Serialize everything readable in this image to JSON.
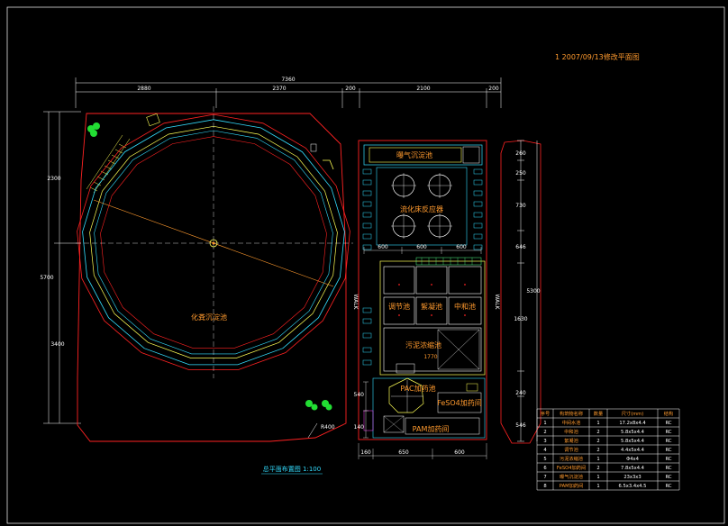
{
  "drawing": {
    "header_note": "1    2007/09/13修改平面图",
    "caption": "总平面布置图 1:100",
    "overall_dim": "7360",
    "top_dims": [
      "2880",
      "2370",
      "200",
      "2100",
      "200"
    ],
    "left_dims": [
      "2300",
      "5700",
      "3400"
    ],
    "right_total": "5300",
    "right_dims": [
      "260",
      "250",
      "730",
      "646",
      "1630",
      "240",
      "546"
    ],
    "mid_dims": [
      "600",
      "600",
      "600"
    ],
    "bottom_dims": [
      "160",
      "650",
      "600"
    ],
    "side_small_dims": [
      "540",
      "140"
    ],
    "walk_labels": [
      "WALK",
      "WALK"
    ],
    "r_label": "R400",
    "labels": {
      "big_tank": "化粪沉淀池",
      "top_room": "曝气沉淀池",
      "reactor_group": "流化床反应器",
      "tank1": "调节池",
      "tank2": "絮凝池",
      "tank3": "中和池",
      "sludge": "污泥浓缩池",
      "sludge_dim": "1770",
      "pac_tank": "PAC加药池",
      "feso4_room": "FeSO4加药间",
      "pam_room": "PAM加药间"
    }
  },
  "legend": {
    "headers": [
      "序号",
      "构筑物名称",
      "数量",
      "尺寸(mm)",
      "结构"
    ],
    "rows": [
      [
        "1",
        "中间水池",
        "1",
        "17.2x8x4.4",
        "RC"
      ],
      [
        "2",
        "中和池",
        "2",
        "5.8x5x4.4",
        "RC"
      ],
      [
        "3",
        "絮凝池",
        "2",
        "5.8x5x4.4",
        "RC"
      ],
      [
        "4",
        "调节池",
        "2",
        "4.4x5x4.4",
        "RC"
      ],
      [
        "5",
        "污泥浓缩池",
        "1",
        "Φ4x4",
        "RC"
      ],
      [
        "6",
        "FeSO4加药间",
        "2",
        "7.8x5x4.4",
        "RC"
      ],
      [
        "7",
        "曝气沉淀池",
        "1",
        "23x3x3",
        "RC"
      ],
      [
        "8",
        "PAM加药间",
        "1",
        "6.5x3.4x4.5",
        "RC"
      ]
    ]
  },
  "colors": {
    "boundary": "#ff2222",
    "cyan": "#33ddff",
    "yellow": "#ffff55",
    "orange": "#ff9a2e",
    "white": "#ffffff",
    "green": "#22dd33",
    "magenta": "#ff44ff"
  }
}
